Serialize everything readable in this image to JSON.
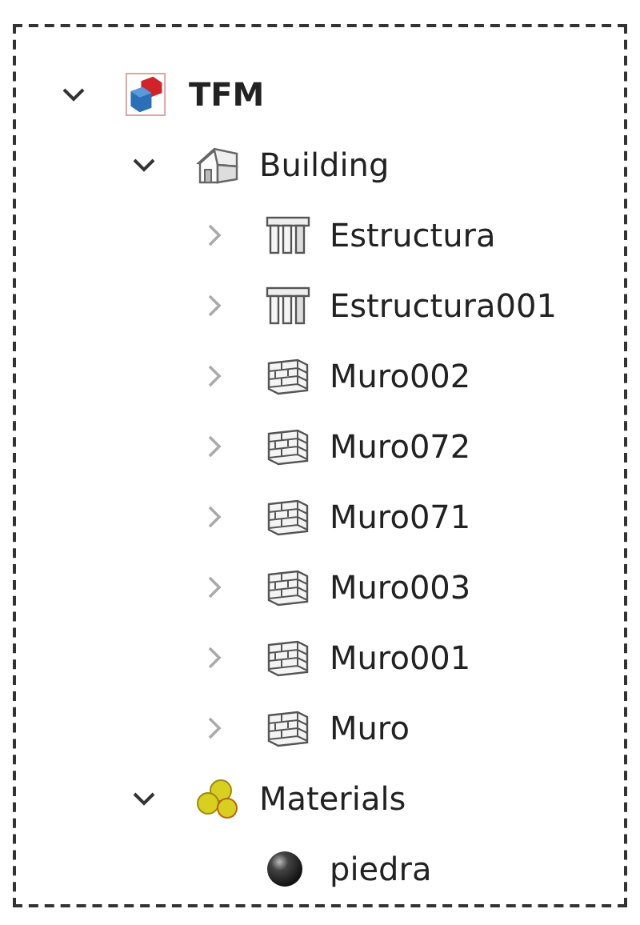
{
  "tree": [
    {
      "label": "TFM",
      "kind": "project",
      "bold": true,
      "expanded": true,
      "children": [
        {
          "label": "Building",
          "kind": "building",
          "expanded": true,
          "children": [
            {
              "label": "Estructura",
              "kind": "structure",
              "expanded": false
            },
            {
              "label": "Estructura001",
              "kind": "structure",
              "expanded": false
            },
            {
              "label": "Muro002",
              "kind": "wall",
              "expanded": false
            },
            {
              "label": "Muro072",
              "kind": "wall",
              "expanded": false
            },
            {
              "label": "Muro071",
              "kind": "wall",
              "expanded": false
            },
            {
              "label": "Muro003",
              "kind": "wall",
              "expanded": false
            },
            {
              "label": "Muro001",
              "kind": "wall",
              "expanded": false
            },
            {
              "label": "Muro",
              "kind": "wall",
              "expanded": false
            }
          ]
        },
        {
          "label": "Materials",
          "kind": "materials",
          "expanded": true,
          "children": [
            {
              "label": "piedra",
              "kind": "material"
            }
          ]
        }
      ]
    }
  ]
}
